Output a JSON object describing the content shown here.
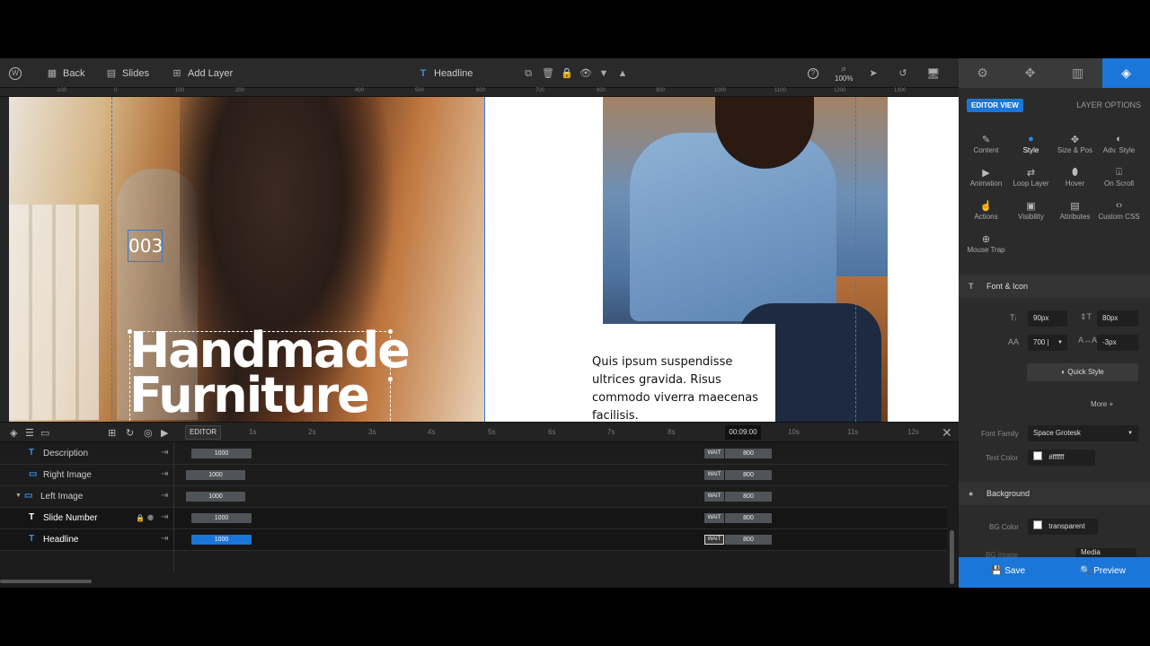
{
  "toolbar": {
    "back_label": "Back",
    "slides_label": "Slides",
    "add_layer_label": "Add Layer",
    "selected_layer": "Headline",
    "zoom": "100%"
  },
  "ruler": {
    "ticks": [
      "-100",
      "0",
      "100",
      "200",
      "400",
      "500",
      "600",
      "700",
      "800",
      "900",
      "1000",
      "1100",
      "1200",
      "1300"
    ]
  },
  "canvas": {
    "slide_number": "003",
    "headline_lines": [
      "Handmade",
      "Furniture"
    ],
    "description": "Quis ipsum suspendisse ultrices gravida. Risus commodo viverra maecenas facilisis."
  },
  "timeline": {
    "editor_label": "EDITOR",
    "scale": [
      "1s",
      "2s",
      "3s",
      "4s",
      "5s",
      "6s",
      "7s",
      "8s",
      "10s",
      "11s",
      "12s"
    ],
    "timecode": "00:09:00",
    "rows": [
      {
        "name": "Description",
        "duration": "1000",
        "wait": "WAIT",
        "out": "800"
      },
      {
        "name": "Right Image",
        "duration": "1000",
        "wait": "WAIT",
        "out": "800"
      },
      {
        "name": "Left Image",
        "duration": "1000",
        "wait": "WAIT",
        "out": "800"
      },
      {
        "name": "Slide Number",
        "duration": "1000",
        "wait": "WAIT",
        "out": "800"
      },
      {
        "name": "Headline",
        "duration": "1000",
        "wait": "WAIT",
        "out": "800"
      }
    ]
  },
  "panel": {
    "editor_view": "EDITOR VIEW",
    "layer_options": "LAYER OPTIONS",
    "tabs": [
      "Content",
      "Style",
      "Size & Pos",
      "Adv. Style",
      "Animation",
      "Loop Layer",
      "Hover",
      "On Scroll",
      "Actions",
      "Visibility",
      "Attributes",
      "Custom CSS",
      "Mouse Trap"
    ],
    "font_section": "Font & Icon",
    "font_size": "90px",
    "line_height": "80px",
    "font_weight": "700 |",
    "letter_spacing": "-3px",
    "quick_style": "Quick Style",
    "more": "More",
    "font_family_label": "Font Family",
    "font_family": "Space Grotesk",
    "text_color_label": "Text Color",
    "text_color": "#ffffff",
    "background_section": "Background",
    "bg_color_label": "BG Color",
    "bg_color": "transparent",
    "bg_image_label": "BG Image",
    "media_label": "Media",
    "save": "Save",
    "preview": "Preview"
  }
}
